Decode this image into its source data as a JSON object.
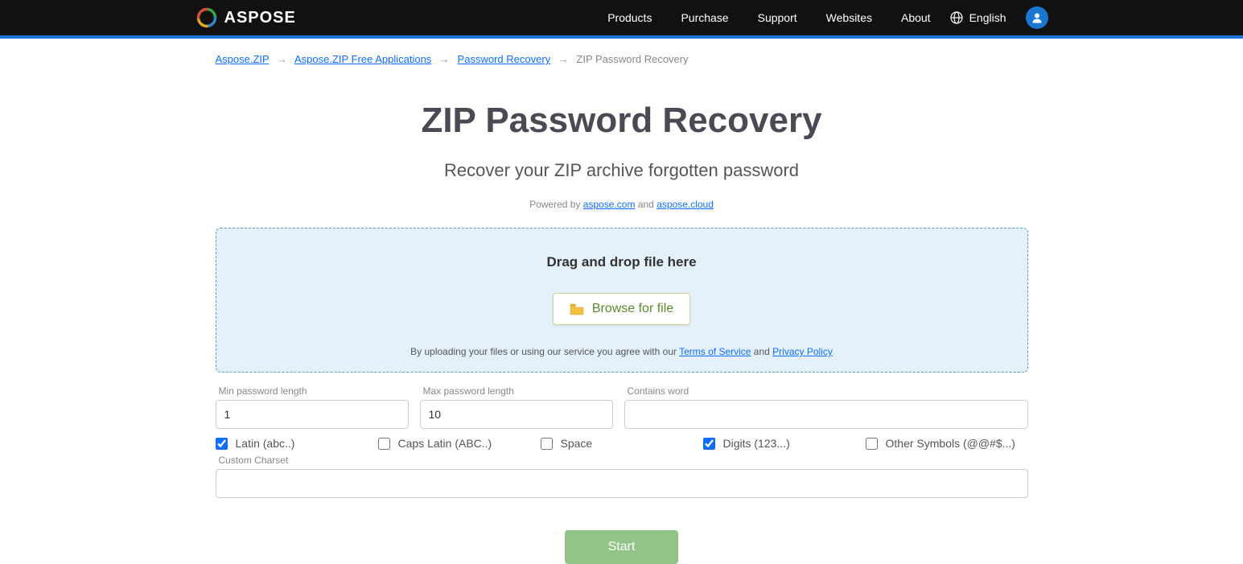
{
  "header": {
    "brand": "ASPOSE",
    "nav": [
      "Products",
      "Purchase",
      "Support",
      "Websites",
      "About"
    ],
    "language": "English"
  },
  "breadcrumb": {
    "items": [
      {
        "label": "Aspose.ZIP",
        "link": true
      },
      {
        "label": "Aspose.ZIP Free Applications",
        "link": true
      },
      {
        "label": "Password Recovery",
        "link": true
      },
      {
        "label": "ZIP Password Recovery",
        "link": false
      }
    ]
  },
  "page": {
    "title": "ZIP Password Recovery",
    "subtitle": "Recover your ZIP archive forgotten password",
    "powered_prefix": "Powered by ",
    "powered_link1": "aspose.com",
    "powered_and": " and ",
    "powered_link2": "aspose.cloud"
  },
  "dropzone": {
    "drag_text": "Drag and drop file here",
    "browse_label": "Browse for file",
    "terms_prefix": "By uploading your files or using our service you agree with our ",
    "terms_link": "Terms of Service",
    "terms_and": " and ",
    "privacy_link": "Privacy Policy"
  },
  "fields": {
    "min_label": "Min password length",
    "min_value": "1",
    "max_label": "Max password length",
    "max_value": "10",
    "contains_label": "Contains word",
    "contains_value": ""
  },
  "checks": {
    "latin": {
      "label": "Latin (abc..)",
      "checked": true
    },
    "caps": {
      "label": "Caps Latin (ABC..)",
      "checked": false
    },
    "space": {
      "label": "Space",
      "checked": false
    },
    "digits": {
      "label": "Digits (123...)",
      "checked": true
    },
    "other": {
      "label": "Other Symbols (@@#$...)",
      "checked": false
    }
  },
  "custom": {
    "label": "Custom Charset",
    "value": ""
  },
  "start": {
    "label": "Start"
  }
}
